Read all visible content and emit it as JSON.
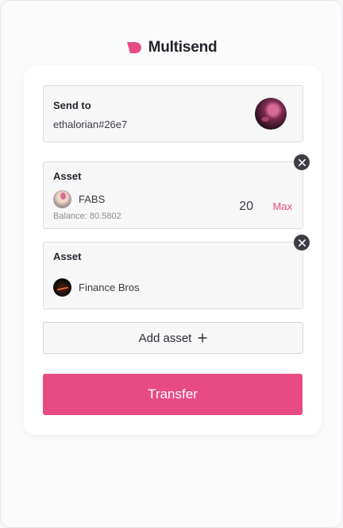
{
  "brand": {
    "name": "Multisend",
    "logo_icon": "multisend-logo-icon",
    "accent": "#e84b84"
  },
  "send_to": {
    "label": "Send to",
    "value": "ethalorian#26e7",
    "avatar_icon": "recipient-avatar"
  },
  "assets": [
    {
      "label": "Asset",
      "token_name": "FABS",
      "token_icon": "fabs-token-icon",
      "balance": "Balance: 80.5802",
      "amount": "20",
      "max_label": "Max",
      "remove_icon": "close-icon"
    },
    {
      "label": "Asset",
      "token_name": "Finance Bros",
      "token_icon": "finance-bros-token-icon",
      "remove_icon": "close-icon"
    }
  ],
  "add_asset": {
    "label": "Add asset",
    "icon": "plus-icon"
  },
  "transfer": {
    "label": "Transfer",
    "color": "#e84b84"
  }
}
